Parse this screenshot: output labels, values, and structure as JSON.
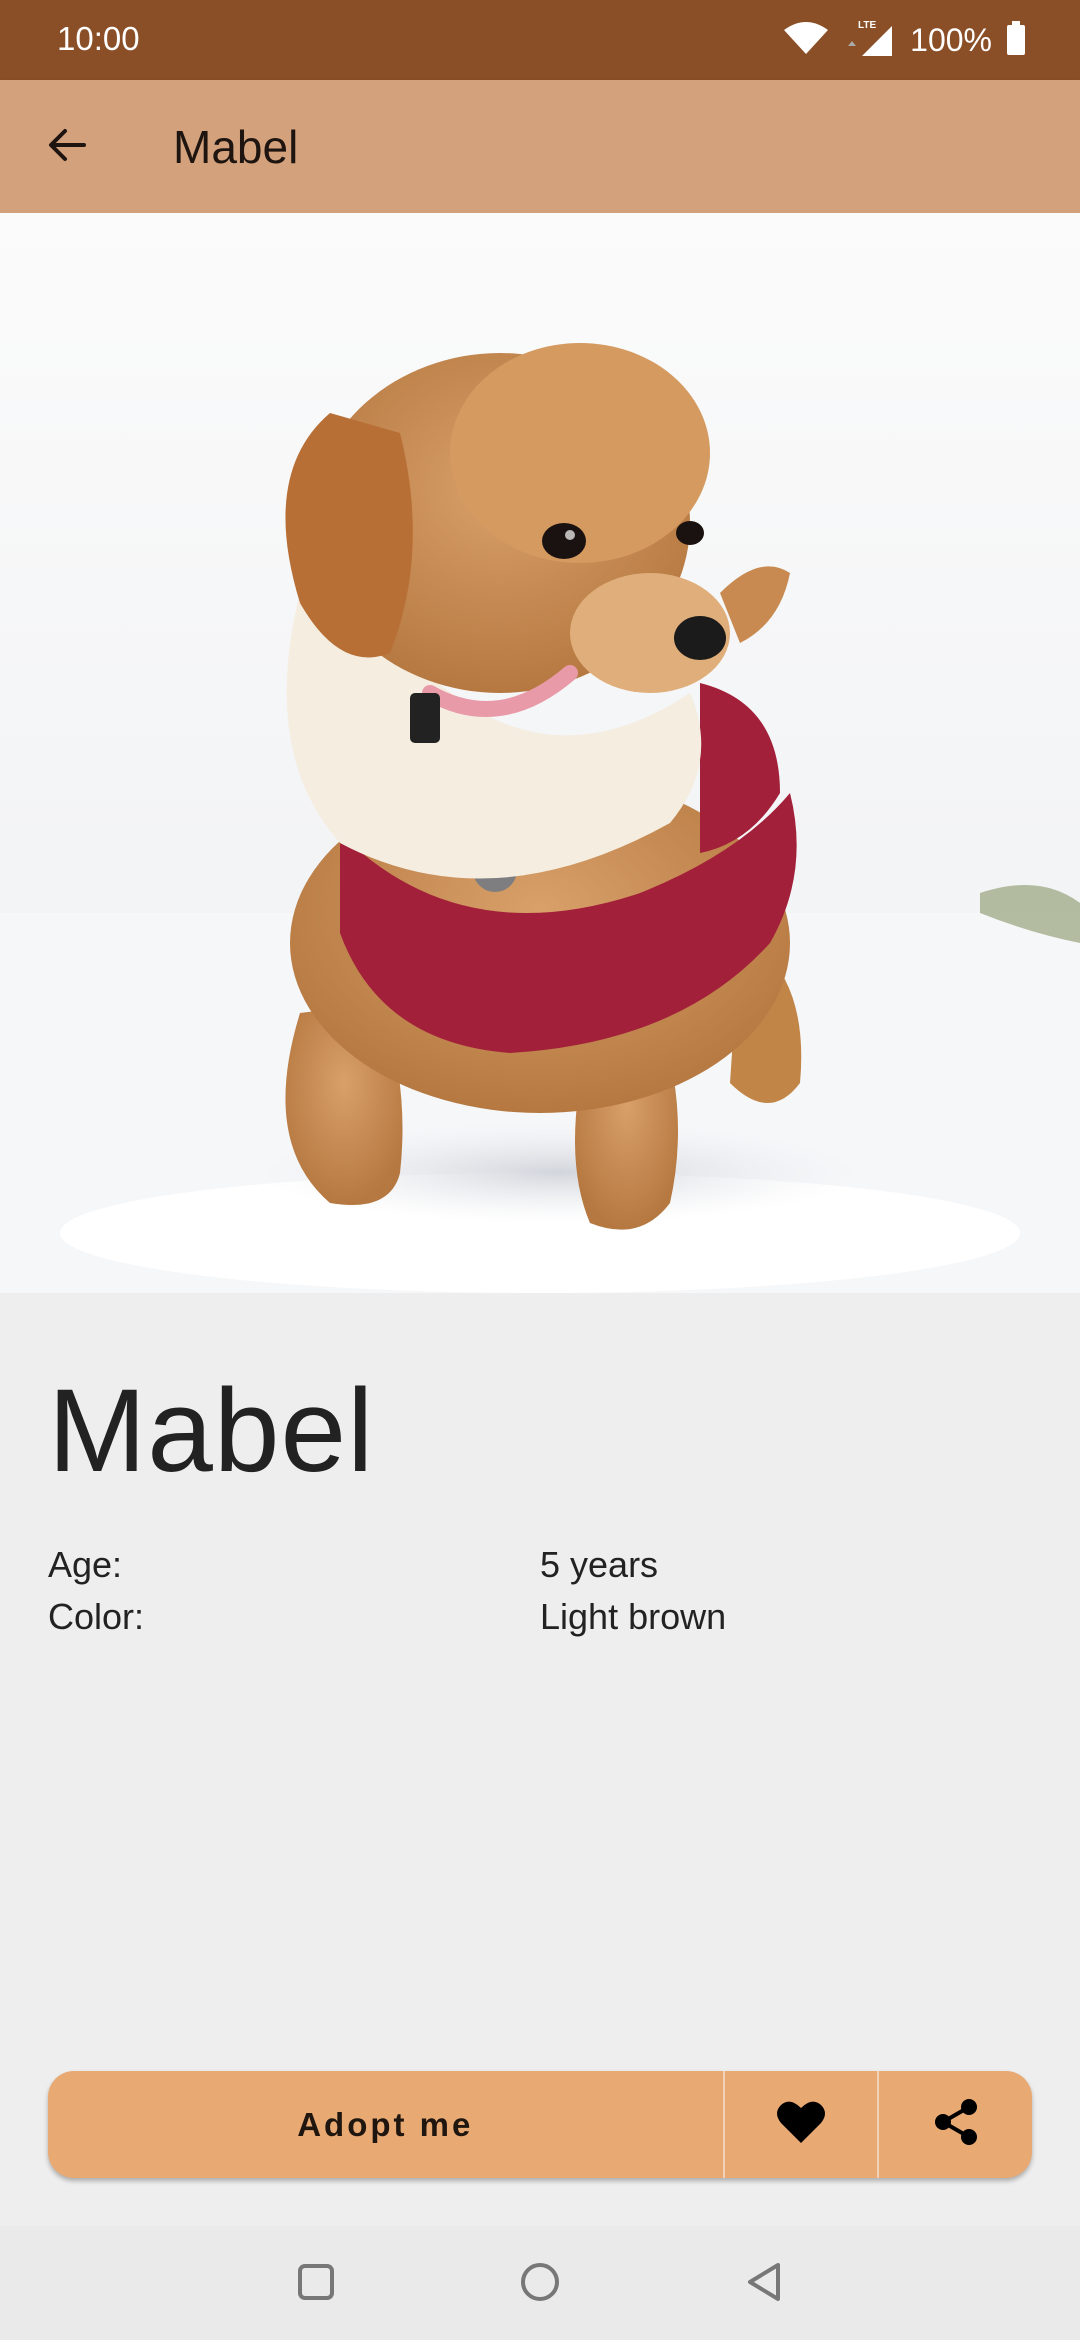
{
  "status_bar": {
    "time": "10:00",
    "network_label": "LTE",
    "battery_text": "100%",
    "icons": [
      "wifi-icon",
      "cellular-signal-icon",
      "battery-icon"
    ]
  },
  "app_bar": {
    "title": "Mabel",
    "back_icon": "arrow-left-icon"
  },
  "hero_image": {
    "subject": "curly light-brown puppy in red winter coat standing in snow"
  },
  "pet": {
    "name": "Mabel",
    "attributes": [
      {
        "label": "Age:",
        "value": "5 years"
      },
      {
        "label": "Color:",
        "value": "Light brown"
      }
    ]
  },
  "actions": {
    "adopt_label": "Adopt me",
    "favorite_icon": "heart-icon",
    "share_icon": "share-icon"
  },
  "navigation_bar": {
    "buttons": [
      "recents-square-icon",
      "home-circle-icon",
      "back-triangle-icon"
    ]
  },
  "colors": {
    "status_bar": "#8a4f26",
    "app_bar": "#d3a27c",
    "button": "#e8a973",
    "background": "#eeeeee"
  }
}
